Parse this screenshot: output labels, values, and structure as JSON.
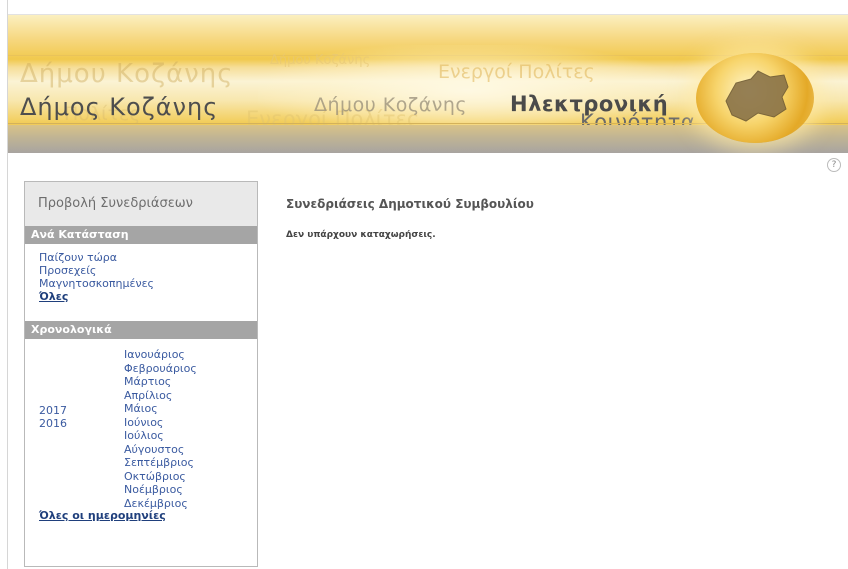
{
  "header": {
    "site_name": "Δήμος Κοζάνης",
    "ghost_texts": [
      "Δήμου Κοζάνης",
      "Πολίτες",
      "Δήμου Κοζάνης",
      "Ενεργοί Πολίτες",
      "Ενεργοί Πολίτες"
    ],
    "municipality": "Δήμου Κοζάνης",
    "ecommunity_line1": "Ηλεκτρονική",
    "ecommunity_line2": "Κοινότητα",
    "help_symbol": "?"
  },
  "sidebar": {
    "title": "Προβολή Συνεδριάσεων",
    "status_section": "Ανά Κατάσταση",
    "status_items": [
      "Παίζουν τώρα",
      "Προσεχείς",
      "Μαγνητοσκοπημένες",
      "Όλες"
    ],
    "chrono_section": "Χρονολογικά",
    "years": [
      "2017",
      "2016"
    ],
    "months": [
      "Ιανουάριος",
      "Φεβρουάριος",
      "Μάρτιος",
      "Απρίλιος",
      "Μάιος",
      "Ιούνιος",
      "Ιούλιος",
      "Αύγουστος",
      "Σεπτέμβριος",
      "Οκτώβριος",
      "Νοέμβριος",
      "Δεκέμβριος"
    ],
    "all_dates": "Όλες οι ημερομηνίες"
  },
  "main": {
    "title": "Συνεδριάσεις Δημοτικού Συμβουλίου",
    "empty_message": "Δεν υπάρχουν καταχωρήσεις."
  },
  "icons": {
    "help": "help-icon",
    "logo": "kozani-map-emblem"
  },
  "colors": {
    "link": "#3a5aa0",
    "section_bar": "#a5a5a5",
    "banner_gold": "#f1c94d"
  }
}
